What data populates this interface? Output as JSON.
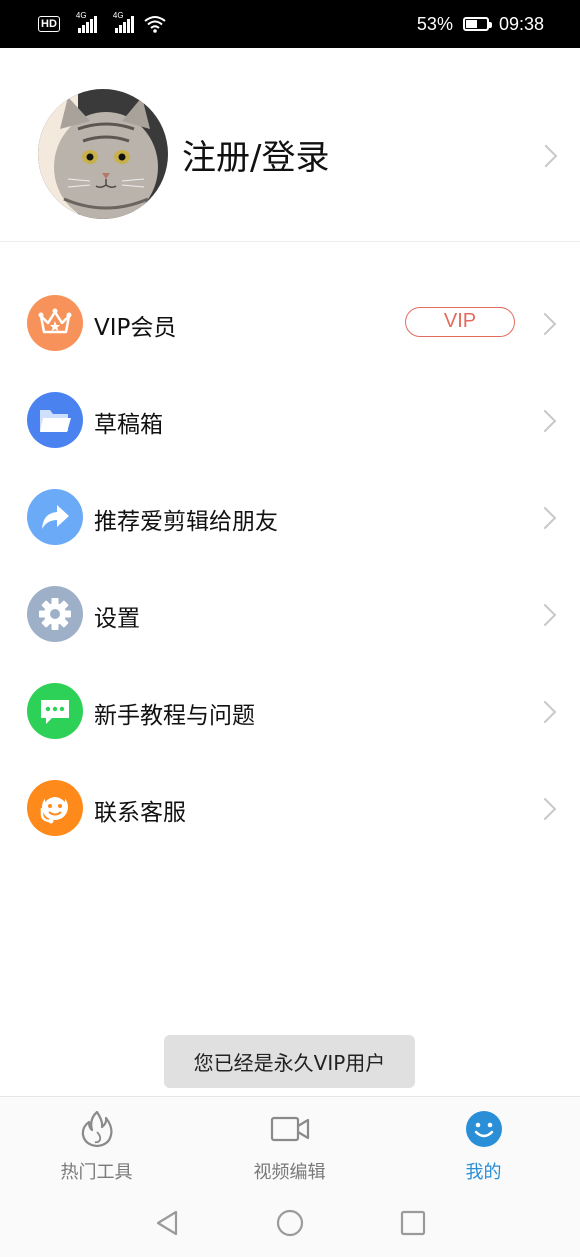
{
  "status_bar": {
    "hd_label": "HD",
    "signal1_label": "4G",
    "signal2_label": "4G",
    "battery_percent_text": "53%",
    "battery_level": 0.53,
    "time": "09:38"
  },
  "profile": {
    "login_label": "注册/登录",
    "avatar_icon": "cat-avatar"
  },
  "menu": {
    "items": [
      {
        "label": "VIP会员",
        "icon": "crown-icon",
        "color": "#f7935a",
        "badge": "VIP"
      },
      {
        "label": "草稿箱",
        "icon": "folder-icon",
        "color": "#4a83f0"
      },
      {
        "label": "推荐爱剪辑给朋友",
        "icon": "share-arrow-icon",
        "color": "#6aaaf7"
      },
      {
        "label": "设置",
        "icon": "gear-icon",
        "color": "#9eb0c8"
      },
      {
        "label": "新手教程与问题",
        "icon": "chat-icon",
        "color": "#2ed158"
      },
      {
        "label": "联系客服",
        "icon": "customer-service-icon",
        "color": "#ff8a1c"
      }
    ],
    "vip_badge_color": "#e36b5e"
  },
  "toast": {
    "text": "您已经是永久VIP用户"
  },
  "tabbar": {
    "tabs": [
      {
        "label": "热门工具",
        "icon": "flame-icon"
      },
      {
        "label": "视频编辑",
        "icon": "video-camera-icon"
      },
      {
        "label": "我的",
        "icon": "smiley-icon",
        "active": true
      }
    ],
    "active_color": "#2a8fd6"
  }
}
